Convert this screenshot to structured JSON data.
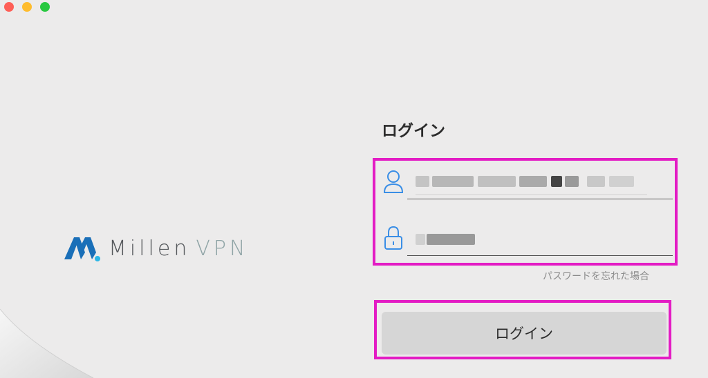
{
  "window": {
    "controls": [
      "close",
      "minimize",
      "maximize"
    ]
  },
  "logo": {
    "brand_primary": "Millen",
    "brand_secondary": "VPN",
    "mark_icon": "millen-m-logo-icon",
    "colors": {
      "mark_blue": "#1a6fb8",
      "dot": "#2bb6e6",
      "millen": "#53565a",
      "vpn": "#8fa4a6"
    }
  },
  "form": {
    "title": "ログイン",
    "username_icon": "user-icon",
    "password_icon": "lock-icon",
    "forgot_password": "パスワードを忘れた場合",
    "submit_label": "ログイン"
  },
  "colors": {
    "highlight": "#e31cc4",
    "icon_blue": "#3a8ee6",
    "button_bg": "#d6d6d6"
  }
}
